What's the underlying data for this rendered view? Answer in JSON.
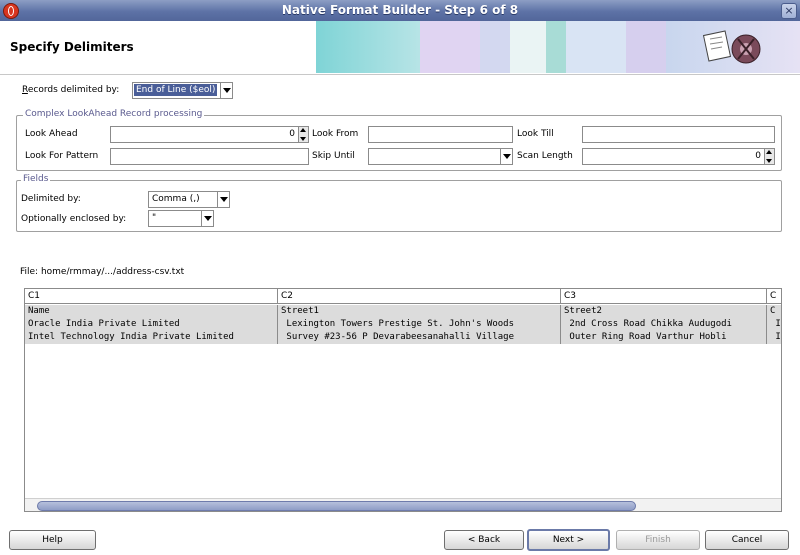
{
  "window": {
    "title": "Native Format Builder - Step 6 of 8",
    "close_glyph": "×"
  },
  "header": {
    "title": "Specify Delimiters"
  },
  "records": {
    "label": "Records delimited by:",
    "value": "End of Line ($eol)"
  },
  "lookahead": {
    "legend": "Complex LookAhead Record processing",
    "look_ahead_label": "Look Ahead",
    "look_ahead_value": "0",
    "look_from_label": "Look From",
    "look_from_value": "",
    "look_till_label": "Look Till",
    "look_till_value": "",
    "look_for_pattern_label": "Look For Pattern",
    "look_for_pattern_value": "",
    "skip_until_label": "Skip Until",
    "skip_until_value": "",
    "scan_length_label": "Scan Length",
    "scan_length_value": "0"
  },
  "fields": {
    "legend": "Fields",
    "delimited_label": "Delimited by:",
    "delimited_value": "Comma (,)",
    "enclosed_label": "Optionally enclosed by:",
    "enclosed_value": "\""
  },
  "file": {
    "label": "File: home/rmmay/.../address-csv.txt"
  },
  "table": {
    "columns": [
      "C1",
      "C2",
      "C3",
      "C"
    ],
    "rows": [
      [
        "Name",
        "Street1",
        "Street2",
        "C"
      ],
      [
        "Oracle India Private Limited",
        " Lexington Towers Prestige St. John's Woods",
        " 2nd Cross Road Chikka Audugodi",
        " I"
      ],
      [
        "Intel Technology India Private Limited",
        " Survey #23-56 P Devarabeesanahalli Village",
        " Outer Ring Road Varthur Hobli",
        " I"
      ]
    ]
  },
  "buttons": {
    "help": "Help",
    "back": "< Back",
    "next": "Next >",
    "finish": "Finish",
    "cancel": "Cancel"
  }
}
